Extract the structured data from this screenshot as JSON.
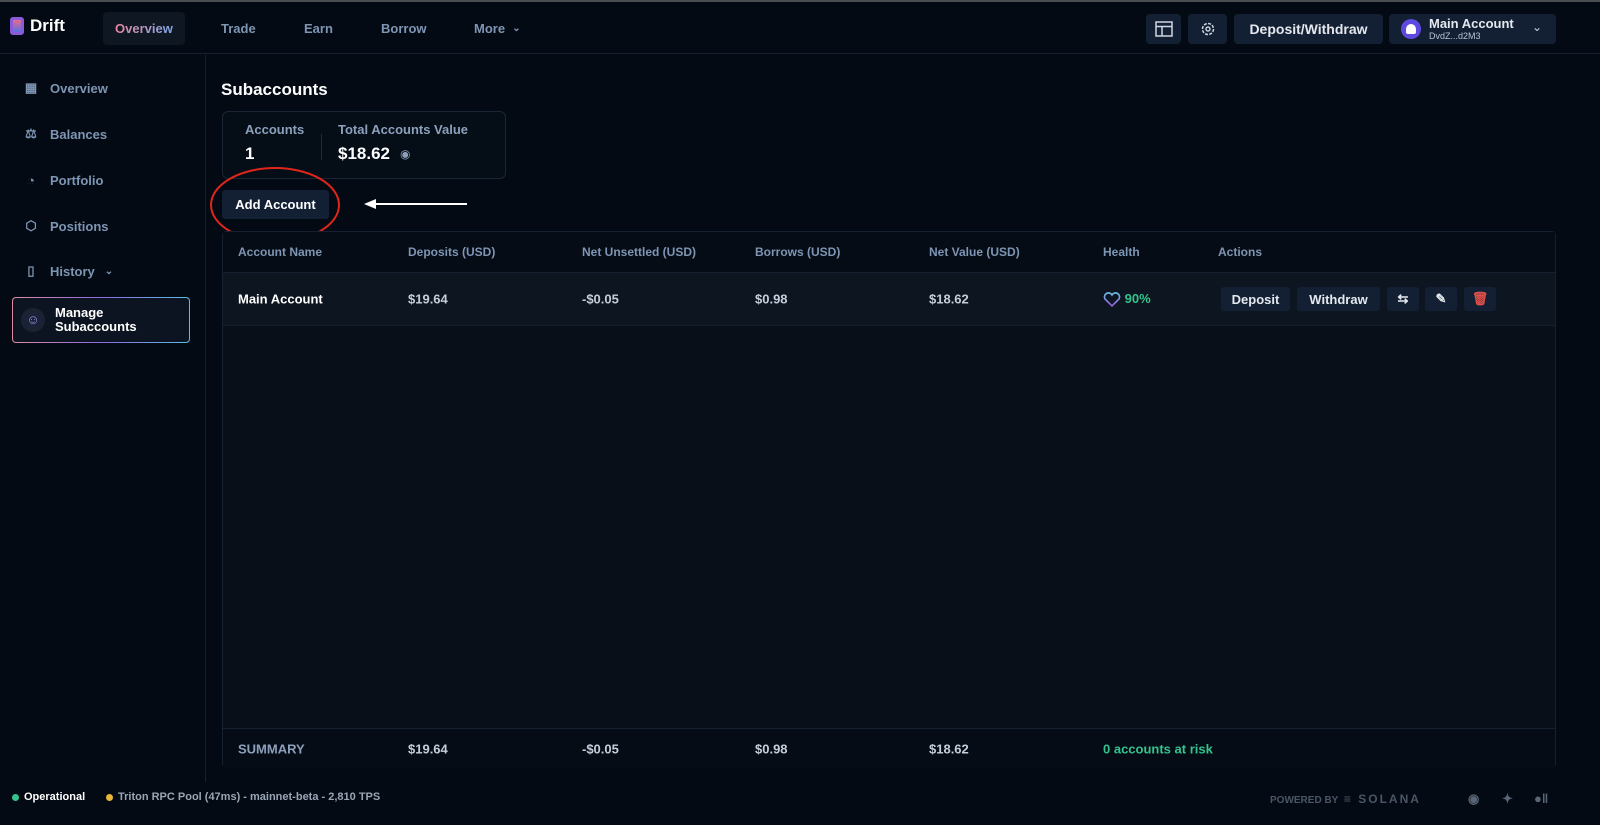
{
  "brand": {
    "name": "Drift"
  },
  "nav": [
    {
      "label": "Overview",
      "active": true
    },
    {
      "label": "Trade"
    },
    {
      "label": "Earn"
    },
    {
      "label": "Borrow"
    },
    {
      "label": "More"
    }
  ],
  "header": {
    "deposit_withdraw": "Deposit/Withdraw",
    "account_name": "Main Account",
    "account_address": "DvdZ...d2M3"
  },
  "sidebar": [
    {
      "label": "Overview",
      "icon": "grid-icon"
    },
    {
      "label": "Balances",
      "icon": "scale-icon"
    },
    {
      "label": "Portfolio",
      "icon": "pie-chart-icon"
    },
    {
      "label": "Positions",
      "icon": "cube-icon"
    },
    {
      "label": "History",
      "icon": "book-icon"
    },
    {
      "label": "Manage Subaccounts",
      "icon": "users-icon",
      "active": true
    }
  ],
  "page": {
    "title": "Subaccounts",
    "accounts_label": "Accounts",
    "accounts_value": "1",
    "total_label": "Total Accounts Value",
    "total_value": "$18.62",
    "add_account": "Add Account"
  },
  "table": {
    "headers": [
      "Account Name",
      "Deposits (USD)",
      "Net Unsettled (USD)",
      "Borrows (USD)",
      "Net Value (USD)",
      "Health",
      "Actions"
    ],
    "rows": [
      {
        "name": "Main Account",
        "deposits": "$19.64",
        "unsettled": "-$0.05",
        "borrows": "$0.98",
        "net": "$18.62",
        "health": "90%",
        "actions": [
          "Deposit",
          "Withdraw"
        ]
      }
    ],
    "summary": {
      "label": "SUMMARY",
      "deposits": "$19.64",
      "unsettled": "-$0.05",
      "borrows": "$0.98",
      "net": "$18.62",
      "risk": "0 accounts at risk"
    }
  },
  "footer": {
    "status": "Operational",
    "rpc": "Triton RPC Pool (47ms) - mainnet-beta - 2,810 TPS",
    "powered": "POWERED BY",
    "solana": "SOLANA"
  },
  "colors": {
    "green": "#33c48d",
    "annotation_red": "#e0261b"
  }
}
